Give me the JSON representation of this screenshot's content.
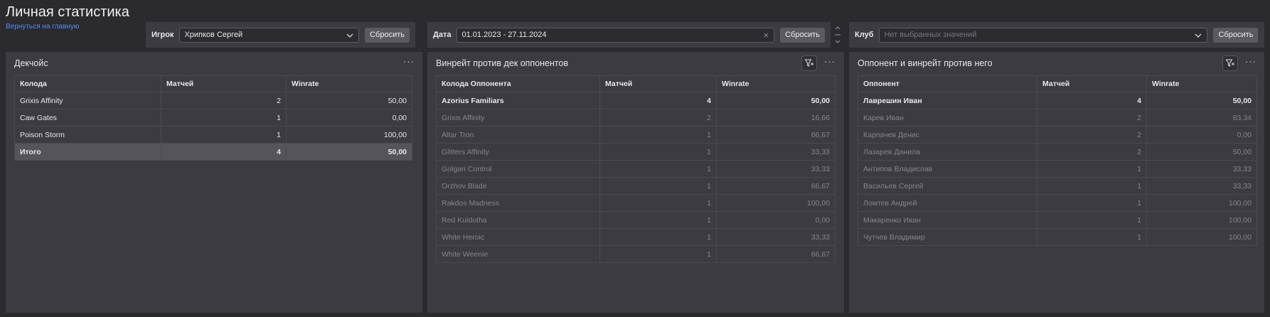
{
  "header": {
    "title": "Личная статистика",
    "back_link": "Вернуться на главную"
  },
  "filters": {
    "player": {
      "label": "Игрок",
      "value": "Хрипков Сергей",
      "reset": "Сбросить"
    },
    "date": {
      "label": "Дата",
      "value": "01.01.2023 - 27.11.2024",
      "reset": "Сбросить"
    },
    "club": {
      "label": "Клуб",
      "placeholder": "Нет выбранных значений",
      "reset": "Сбросить"
    }
  },
  "deck_choice": {
    "title": "Декчойс",
    "menu": "···",
    "columns": [
      "Колода",
      "Матчей",
      "Winrate"
    ],
    "rows": [
      [
        "Grixis Affinity",
        "2",
        "50,00"
      ],
      [
        "Caw Gates",
        "1",
        "0,00"
      ],
      [
        "Poison Storm",
        "1",
        "100,00"
      ]
    ],
    "total": [
      "Итого",
      "4",
      "50,00"
    ]
  },
  "vs_decks": {
    "title": "Винрейт против дек оппонентов",
    "menu": "···",
    "columns": [
      "Колода Оппонента",
      "Матчей",
      "Winrate"
    ],
    "rows": [
      [
        "Azorius Familiars",
        "4",
        "50,00"
      ],
      [
        "Grixis Affinity",
        "2",
        "16,66"
      ],
      [
        "Altar Tron",
        "1",
        "66,67"
      ],
      [
        "Glitters Affinity",
        "1",
        "33,33"
      ],
      [
        "Golgari Control",
        "1",
        "33,33"
      ],
      [
        "Orzhov Blade",
        "1",
        "66,67"
      ],
      [
        "Rakdos Madness",
        "1",
        "100,00"
      ],
      [
        "Red Kuldotha",
        "1",
        "0,00"
      ],
      [
        "White Heroic",
        "1",
        "33,33"
      ],
      [
        "White Weenie",
        "1",
        "66,67"
      ]
    ]
  },
  "vs_opponents": {
    "title": "Оппонент и винрейт против него",
    "menu": "···",
    "columns": [
      "Оппонент",
      "Матчей",
      "Winrate"
    ],
    "rows": [
      [
        "Лаврешин Иван",
        "4",
        "50,00"
      ],
      [
        "Карев Иван",
        "2",
        "83,34"
      ],
      [
        "Карпачев Денис",
        "2",
        "0,00"
      ],
      [
        "Лазарев Данила",
        "2",
        "50,00"
      ],
      [
        "Антипов Владислав",
        "1",
        "33,33"
      ],
      [
        "Васильев Сергей",
        "1",
        "33,33"
      ],
      [
        "Ломтев Андрей",
        "1",
        "100,00"
      ],
      [
        "Макаренко Иван",
        "1",
        "100,00"
      ],
      [
        "Чутчев Владимир",
        "1",
        "100,00"
      ]
    ]
  },
  "colors": {
    "background": "#2a2a2f",
    "panel": "#3b3b41",
    "link": "#5a8dee",
    "dim_text": "#85858b",
    "total_row": "#54545a"
  }
}
